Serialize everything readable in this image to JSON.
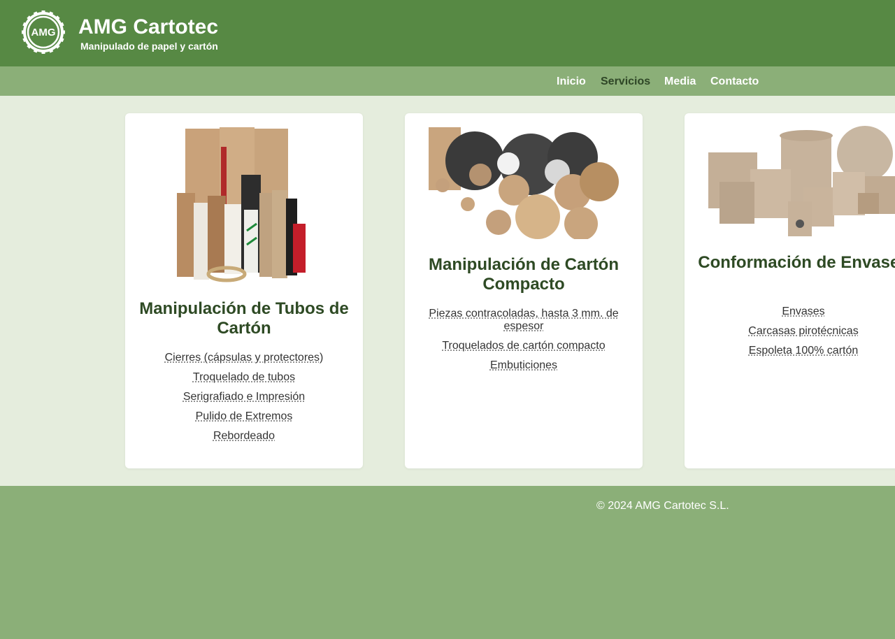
{
  "header": {
    "logo_text": "AMG",
    "title": "AMG Cartotec",
    "subtitle": "Manipulado de papel y cartón"
  },
  "nav": {
    "items": [
      {
        "label": "Inicio",
        "active": false
      },
      {
        "label": "Servicios",
        "active": true
      },
      {
        "label": "Media",
        "active": false
      },
      {
        "label": "Contacto",
        "active": false
      }
    ]
  },
  "cards": [
    {
      "title": "Manipulación de Tubos de Cartón",
      "image": "cardboard-tubes-photo",
      "links": [
        "Cierres (cápsulas y protectores)",
        "Troquelado de tubos",
        "Serigrafiado e Impresión",
        "Pulido de Extremos",
        "Rebordeado"
      ]
    },
    {
      "title": "Manipulación de Cartón Compacto",
      "image": "compact-cardboard-pieces-photo",
      "links": [
        "Piezas contracoladas, hasta 3 mm. de espesor",
        "Troquelados de cartón compacto",
        "Embuticiones"
      ]
    },
    {
      "title": "Conformación de Envases",
      "image": "cardboard-containers-photo",
      "links": [
        "Envases",
        "Carcasas pirotécnicas",
        "Espoleta 100% cartón"
      ]
    }
  ],
  "footer": {
    "copyright": "© 2024 AMG Cartotec S.L."
  },
  "colors": {
    "header_bg": "#578944",
    "nav_bg": "#8baf78",
    "main_bg": "#e5eddd",
    "title_green": "#2e4a24"
  }
}
